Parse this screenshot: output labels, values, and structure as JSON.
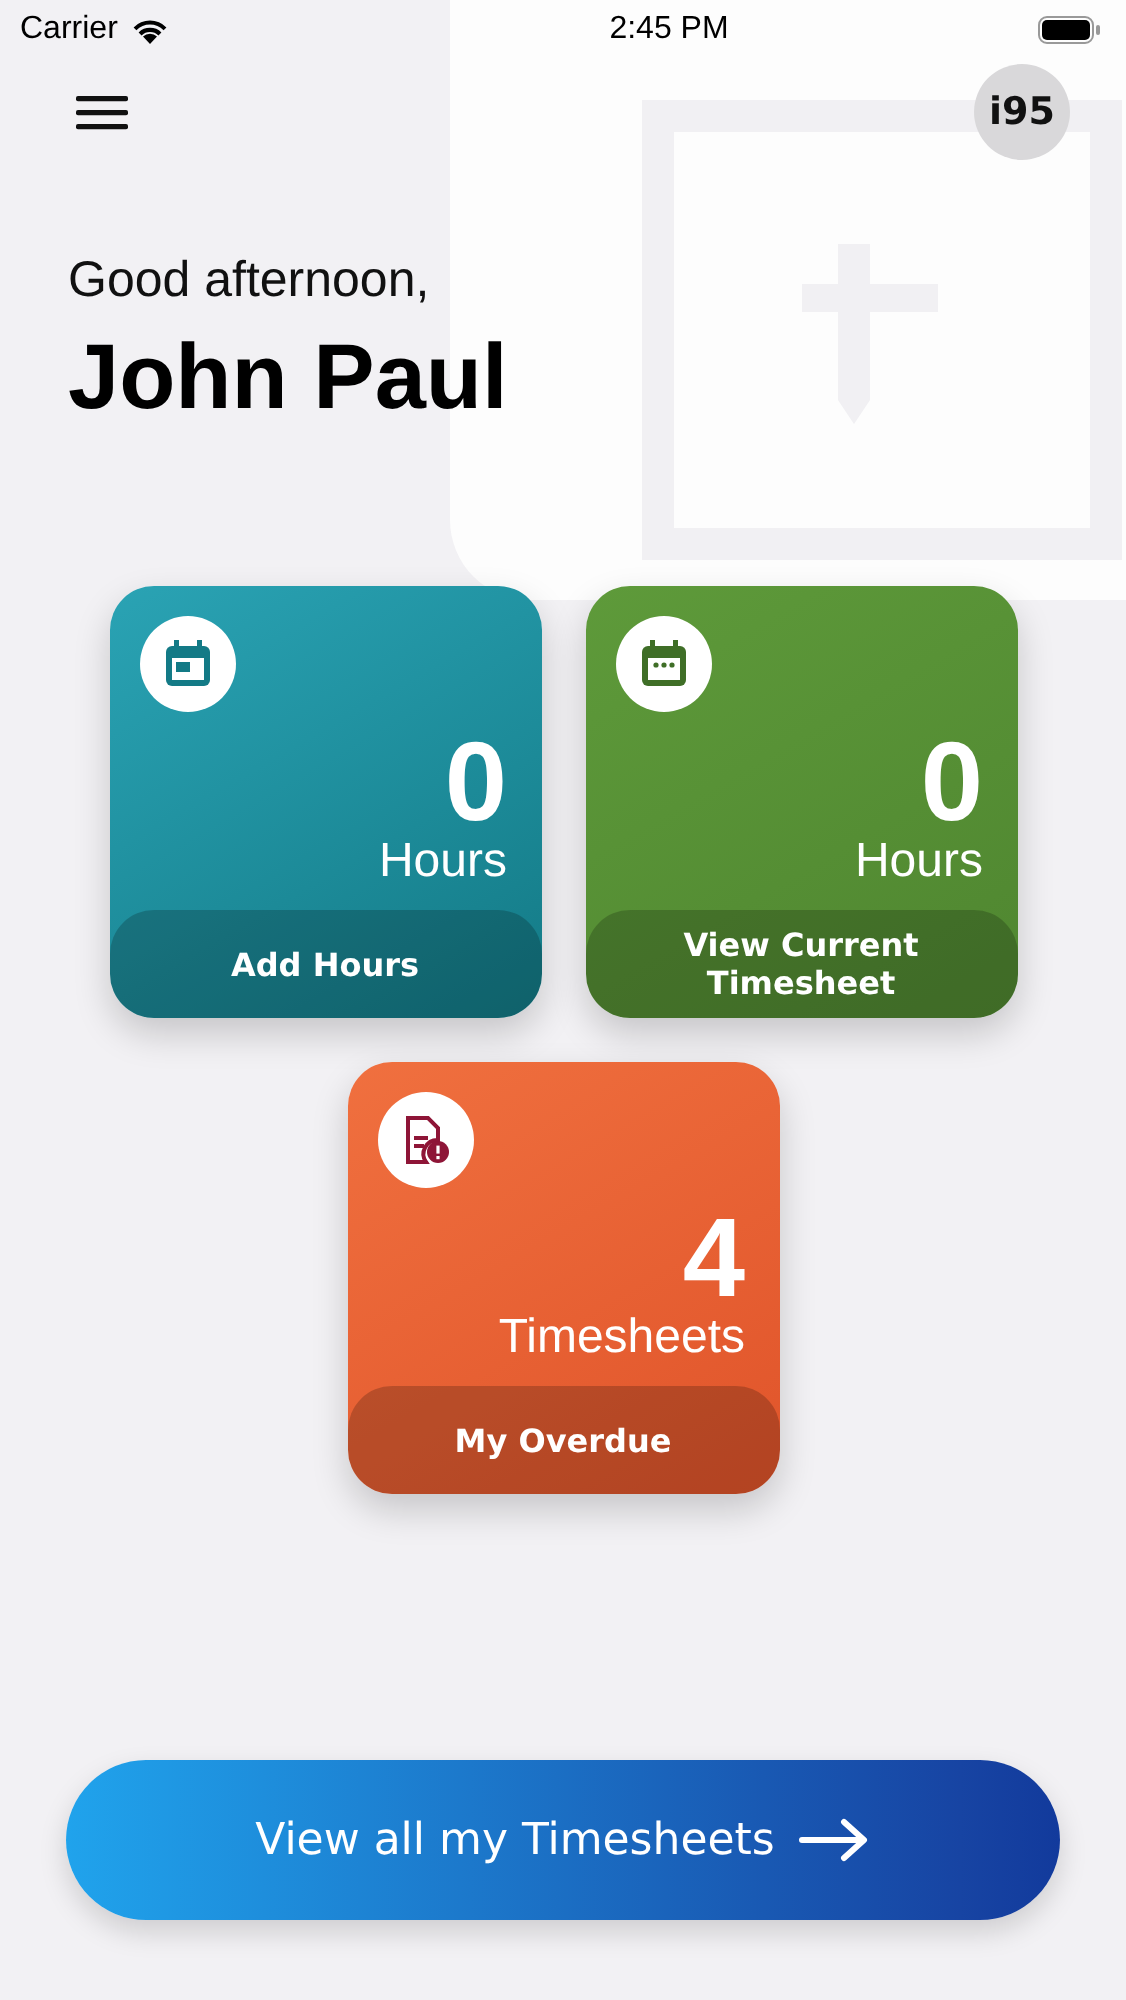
{
  "status_bar": {
    "carrier": "Carrier",
    "time": "2:45 PM"
  },
  "header": {
    "avatar_text": "i95"
  },
  "greeting": "Good afternoon,",
  "user_name": "John Paul",
  "cards": [
    {
      "kind": "calendar",
      "color": "#2aa3b4",
      "value": "0",
      "unit": "Hours",
      "action": "Add Hours"
    },
    {
      "kind": "calendar-dots",
      "color": "#5e9a3a",
      "value": "0",
      "unit": "Hours",
      "action": "View Current Timesheet"
    },
    {
      "kind": "document-alert",
      "color": "#f0703f",
      "value": "4",
      "unit": "Timesheets",
      "action": "My Overdue"
    }
  ],
  "primary_button": {
    "label": "View all my Timesheets"
  }
}
